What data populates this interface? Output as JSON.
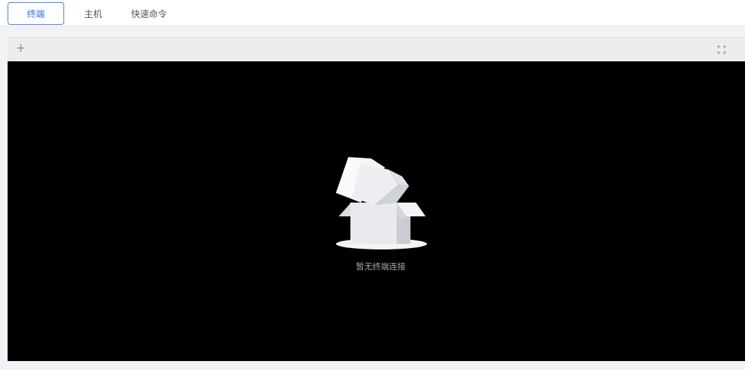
{
  "tabs": [
    {
      "label": "终端",
      "active": true
    },
    {
      "label": "主机",
      "active": false
    },
    {
      "label": "快速命令",
      "active": false
    }
  ],
  "toolbar": {
    "add_icon": "+",
    "fullscreen_icon": "fullscreen-icon"
  },
  "terminal": {
    "empty_text": "暂无终端连接",
    "illustration": "empty-box-icon"
  },
  "colors": {
    "accent": "#2f6fdc",
    "terminal_bg": "#000000",
    "toolbar_bg": "#ececec"
  }
}
